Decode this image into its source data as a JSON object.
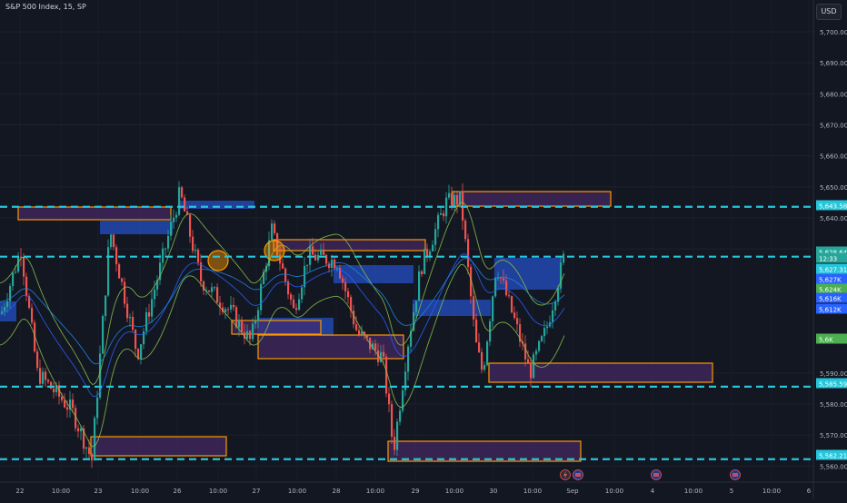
{
  "header": {
    "title": "S&P 500 Index, 15, SP",
    "currency_button": "USD"
  },
  "colors": {
    "background": "#131722",
    "bull": "#26a69a",
    "bear": "#ef5350",
    "level_line": "#26c6da",
    "box_border": "#ff9800",
    "box_fill": "#4a2a6a",
    "blue_zone": "#2962ff"
  },
  "chart_data": {
    "type": "candlestick",
    "symbol": "S&P 500 Index",
    "interval": "15",
    "exchange": "SP",
    "x_ticks": [
      "22",
      "10:00",
      "23",
      "10:00",
      "26",
      "10:00",
      "27",
      "10:00",
      "28",
      "10:00",
      "29",
      "10:00",
      "30",
      "10:00",
      "Sep",
      "10:00",
      "4",
      "10:00",
      "5",
      "10:00",
      "6"
    ],
    "y_ticks": [
      "5,700.00",
      "5,690.00",
      "5,680.00",
      "5,670.00",
      "5,660.00",
      "5,650.00",
      "5,640.00",
      "5,630.00",
      "5,590.00",
      "5,580.00",
      "5,570.00",
      "5,560.00"
    ],
    "ylim": [
      5560,
      5712
    ],
    "horizontal_levels": [
      5643.58,
      5627.5,
      5585.59,
      5562.21
    ],
    "price_labels": [
      {
        "text": "5,643.58",
        "color": "#26c6da"
      },
      {
        "text": "5,628.64",
        "color": "#26a69a"
      },
      {
        "text": "12:33",
        "color": "#26a69a"
      },
      {
        "text": "5,627.31",
        "color": "#26c6da"
      },
      {
        "text": "5,627K",
        "color": "#2962ff"
      },
      {
        "text": "5,624K",
        "color": "#4caf50"
      },
      {
        "text": "5,616K",
        "color": "#2962ff"
      },
      {
        "text": "5,612K",
        "color": "#2962ff"
      },
      {
        "text": "5,6K",
        "color": "#4caf50"
      },
      {
        "text": "5,585.59",
        "color": "#26c6da"
      },
      {
        "text": "5,562.21",
        "color": "#26c6da"
      }
    ],
    "event_icons": [
      "lightning-icon",
      "us-flag-icon",
      "us-flag-icon",
      "us-flag-icon"
    ]
  }
}
